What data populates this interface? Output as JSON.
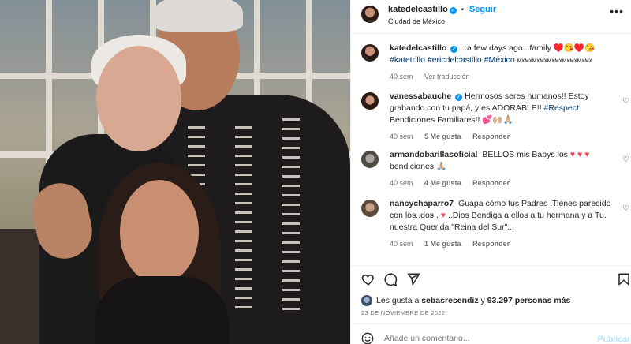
{
  "post": {
    "header": {
      "username": "katedelcastillo",
      "verified": true,
      "follow_sep": "•",
      "follow_label": "Seguir",
      "location": "Ciudad de México",
      "more_icon": "more-horizontal-icon"
    },
    "caption": {
      "username": "katedelcastillo",
      "text": "...a few days ago...family ♥️😘♥️😘",
      "tags": [
        "#katetrillo",
        "#ericdelcastillo",
        "#México"
      ],
      "tail": "мхмхмхмхмхмхмхмхмхмх",
      "time": "40 sem",
      "translate_label": "Ver traducción"
    },
    "comments": [
      {
        "username": "vanessabauche",
        "verified": true,
        "text": "Hermosos seres humanos!! Estoy grabando con tu papá, y es ADORABLE!!",
        "tag": "#Respect",
        "text2": "Bendiciones Familiares!! 💕🙌🏼🙏🏼",
        "time": "40 sem",
        "likes": "5 Me gusta",
        "reply_label": "Responder"
      },
      {
        "username": "armandobarillasoficial",
        "verified": false,
        "text": "BELLOS mis Babys los",
        "hearts": "♥ ♥ ♥",
        "text2": "bendiciones 🙏🏼",
        "time": "40 sem",
        "likes": "4 Me gusta",
        "reply_label": "Responder"
      },
      {
        "username": "nancychaparro7",
        "verified": false,
        "text": "Guapa cómo tus Padres .Tienes parecido con los..dos..",
        "hearts": "♥",
        "text2": "..Dios Bendiga a ellos a tu hermana y a Tu. nuestra Querida \"Reina del Sur\"...",
        "time": "40 sem",
        "likes": "1 Me gusta",
        "reply_label": "Responder"
      }
    ],
    "actions": {
      "like_icon": "heart-icon",
      "comment_icon": "comment-icon",
      "share_icon": "share-icon",
      "save_icon": "bookmark-icon"
    },
    "likes": {
      "prefix": "Les gusta a",
      "user": "sebasresendiz",
      "connector": "y",
      "count": "93.297 personas más"
    },
    "date": "23 DE NOVIEMBRE DE 2022",
    "add_comment": {
      "placeholder": "Añade un comentario...",
      "post_label": "Publicar",
      "emoji_icon": "smiley-icon"
    }
  },
  "colors": {
    "accent": "#0095f6",
    "link": "#00376b",
    "secondary_text": "#737373",
    "heart": "#ed4956",
    "post_disabled": "#b2dffc"
  }
}
